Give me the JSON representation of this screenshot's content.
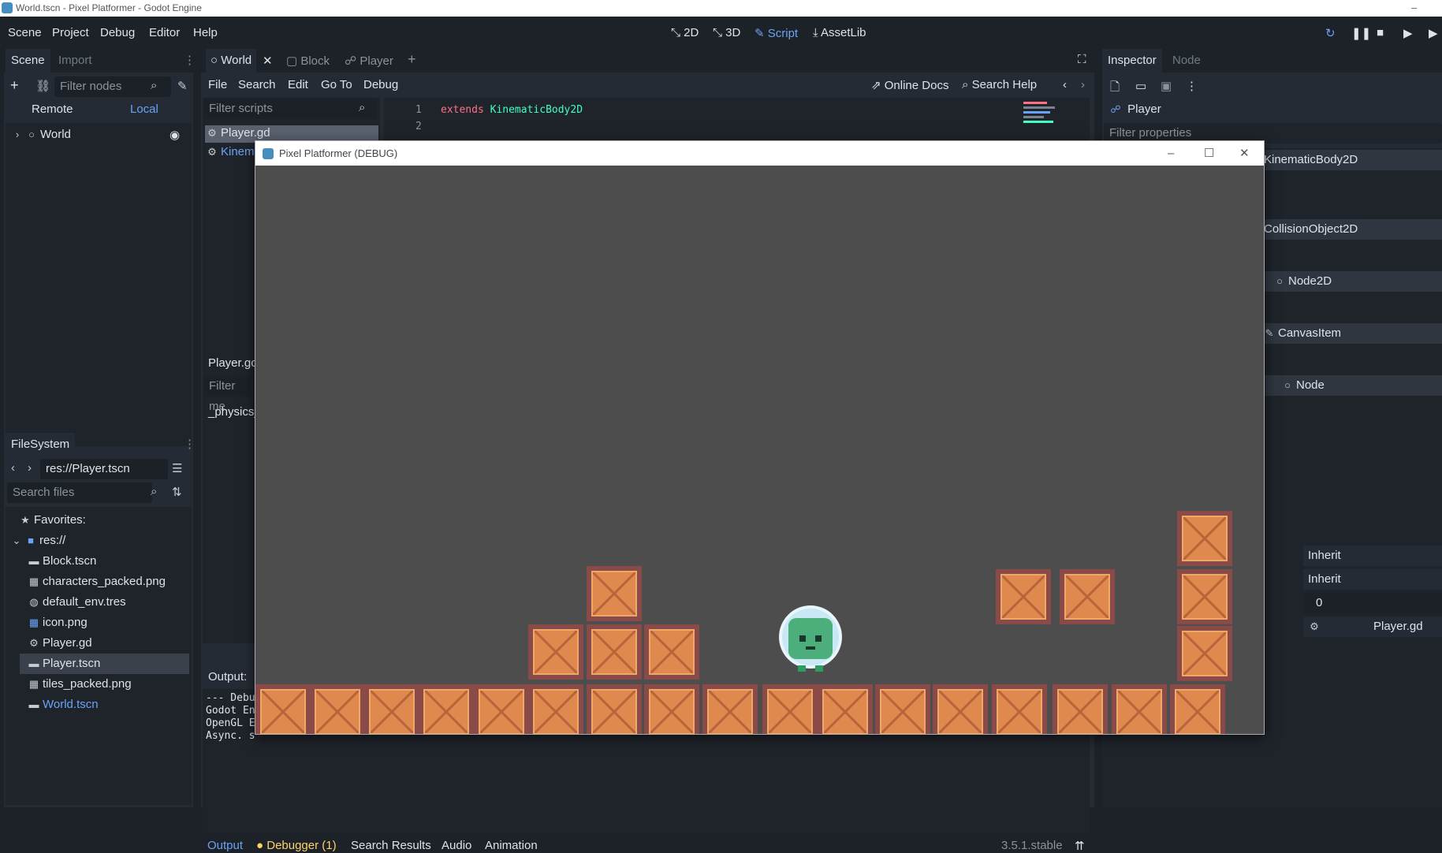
{
  "window": {
    "title": "World.tscn - Pixel Platformer - Godot Engine",
    "min": "–"
  },
  "menu": [
    "Scene",
    "Project",
    "Debug",
    "Editor",
    "Help"
  ],
  "workspaces": [
    "2D",
    "3D",
    "Script",
    "AssetLib"
  ],
  "scene_dock": {
    "tabs": [
      "Scene",
      "Import"
    ],
    "filter_placeholder": "Filter nodes",
    "remote": "Remote",
    "local": "Local",
    "root": "World"
  },
  "filesystem": {
    "title": "FileSystem",
    "path": "res://Player.tscn",
    "search_placeholder": "Search files",
    "favorites": "Favorites:",
    "root": "res://",
    "files": [
      "Block.tscn",
      "characters_packed.png",
      "default_env.tres",
      "icon.png",
      "Player.gd",
      "Player.tscn",
      "tiles_packed.png",
      "World.tscn"
    ],
    "selected": "Player.tscn"
  },
  "editor_tabs": [
    "World",
    "Block",
    "Player"
  ],
  "script_menu": [
    "File",
    "Search",
    "Edit",
    "Go To",
    "Debug"
  ],
  "script_tools": {
    "online_docs": "Online Docs",
    "search_help": "Search Help"
  },
  "scripts": {
    "filter_placeholder": "Filter scripts",
    "items": [
      "Player.gd",
      "Kinem"
    ],
    "methods_title": "Player.gc",
    "methods_filter": "Filter me",
    "methods": [
      "_physics_"
    ]
  },
  "code": {
    "lines": [
      {
        "n": "1",
        "kw": "extends",
        "ty": "KinematicBody2D"
      },
      {
        "n": "2",
        "kw": "",
        "ty": ""
      }
    ]
  },
  "output": {
    "title": "Output:",
    "lines": [
      "--- Debu",
      "Godot En",
      "OpenGL E",
      "Async. s"
    ]
  },
  "bottom_tabs": [
    "Output",
    "Debugger (1)",
    "Search Results",
    "Audio",
    "Animation"
  ],
  "version": "3.5.1.stable",
  "inspector": {
    "tabs": [
      "Inspector",
      "Node"
    ],
    "object": "Player",
    "filter_placeholder": "Filter properties",
    "sections": [
      "KinematicBody2D",
      "CollisionObject2D",
      "Node2D",
      "CanvasItem",
      "Node"
    ],
    "values": [
      "Inherit",
      "Inherit",
      "0",
      "Player.gd"
    ]
  },
  "game": {
    "title": "Pixel Platformer (DEBUG)",
    "colors": {
      "bg": "#4d4d4d",
      "crate": "#e0894e",
      "crate_border": "#8a4a48"
    }
  }
}
